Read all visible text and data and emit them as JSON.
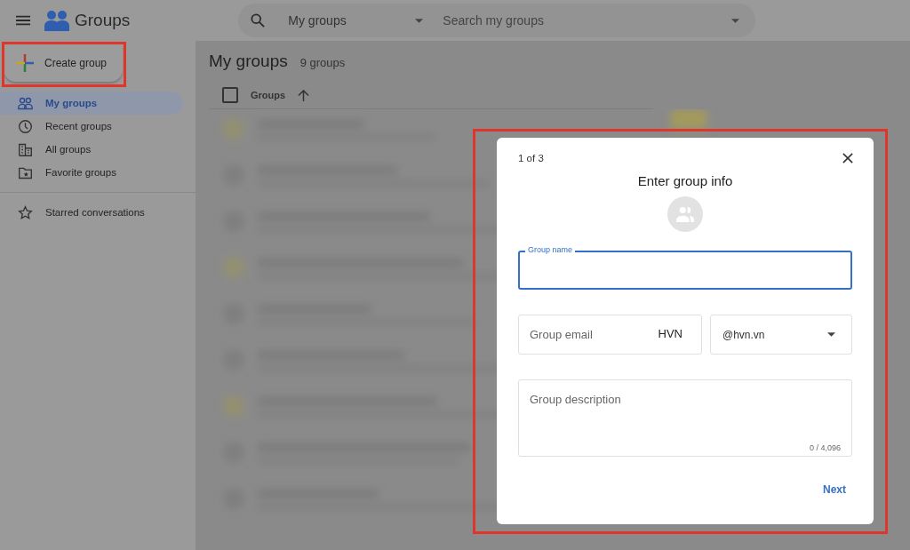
{
  "app": {
    "title": "Groups"
  },
  "search": {
    "scope": "My groups",
    "placeholder": "Search my groups"
  },
  "sidebar": {
    "create_button": {
      "label": "Create group",
      "annotated": true
    },
    "items": [
      {
        "label": "My groups",
        "kind": "people",
        "selected": true
      },
      {
        "label": "Recent groups",
        "kind": "clock",
        "selected": false
      },
      {
        "label": "All groups",
        "kind": "building",
        "selected": false
      },
      {
        "label": "Favorite groups",
        "kind": "folder",
        "selected": false
      }
    ],
    "extra_items": [
      {
        "label": "Starred conversations",
        "kind": "star",
        "selected": false
      }
    ]
  },
  "main": {
    "title": "My groups",
    "count": "9 groups",
    "column": "Groups",
    "all_checked": false
  },
  "dialog": {
    "annotated": true,
    "step": "1 of 3",
    "title": "Enter group info",
    "group_name": {
      "label": "Group name",
      "focused": true
    },
    "group_email": {
      "placeholder": "Group email",
      "suffix": "HVN"
    },
    "domain": {
      "value": "@hvn.vn"
    },
    "description": {
      "placeholder": "Group description",
      "counter": "0 / 4,096"
    },
    "next_button": "Next"
  }
}
